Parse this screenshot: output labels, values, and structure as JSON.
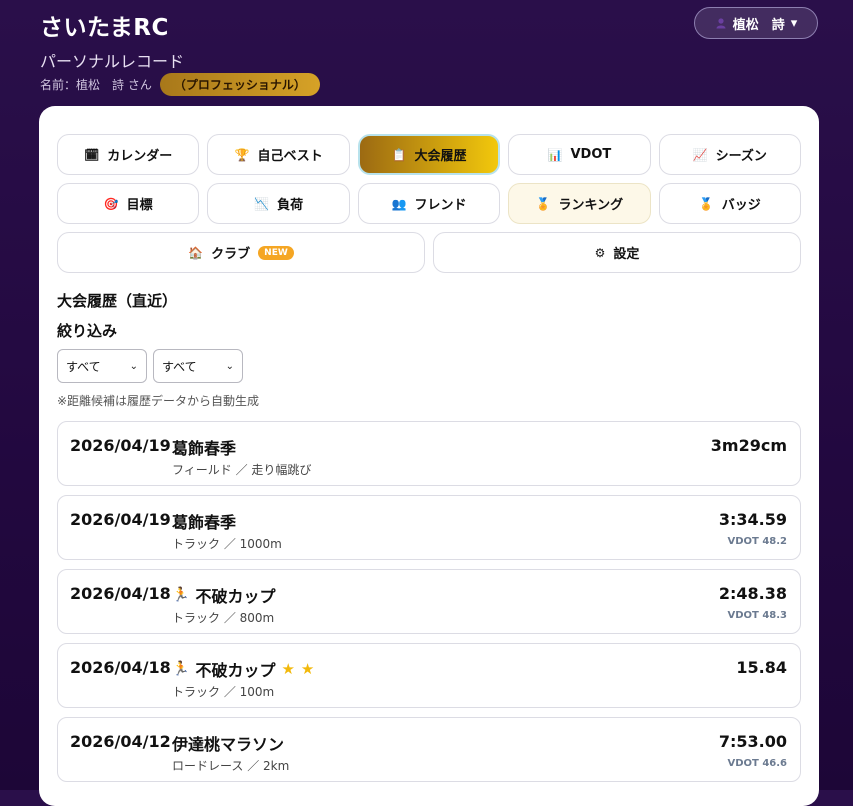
{
  "header": {
    "app_title": "さいたまRC",
    "subtitle": "パーソナルレコード",
    "name_line": "名前：植松　詩 さん",
    "rank": "（プロフェッショナル）"
  },
  "user_menu": {
    "label": "植松　詩",
    "chevron": "▾",
    "icon": "user-icon"
  },
  "tabs": [
    {
      "label": "カレンダー",
      "icon": "🗓"
    },
    {
      "label": "自己ベスト",
      "icon": "🏆"
    },
    {
      "label": "大会履歴",
      "icon": "📋",
      "active": true
    },
    {
      "label": "VDOT",
      "icon": "📊"
    },
    {
      "label": "シーズン",
      "icon": "📈"
    },
    {
      "label": "目標",
      "icon": "🎯"
    },
    {
      "label": "負荷",
      "icon": "📉"
    },
    {
      "label": "フレンド",
      "icon": "👥"
    },
    {
      "label": "ランキング",
      "icon": "🏅"
    },
    {
      "label": "バッジ",
      "icon": "🏅"
    }
  ],
  "tabs_row2": [
    {
      "label": "クラブ",
      "icon": "🏠",
      "badge": "NEW"
    },
    {
      "label": "設定",
      "icon": "⚙"
    }
  ],
  "section_title": "大会履歴（直近）",
  "filter_title": "絞り込み",
  "filters": [
    {
      "value": "すべて"
    },
    {
      "value": "すべて"
    }
  ],
  "note": "※距離候補は履歴データから自動生成",
  "races": [
    {
      "date": "2026/04/19",
      "name": "葛飾春季",
      "category": "フィールド ／ 走り幅跳び",
      "result": "3m29cm",
      "vdot": "",
      "runner_icon": false,
      "stars": 0
    },
    {
      "date": "2026/04/19",
      "name": "葛飾春季",
      "category": "トラック ／ 1000m",
      "result": "3:34.59",
      "vdot": "VDOT 48.2",
      "runner_icon": false,
      "stars": 0
    },
    {
      "date": "2026/04/18",
      "name": "不破カップ",
      "category": "トラック ／ 800m",
      "result": "2:48.38",
      "vdot": "VDOT 48.3",
      "runner_icon": true,
      "stars": 0
    },
    {
      "date": "2026/04/18",
      "name": "不破カップ",
      "category": "トラック ／ 100m",
      "result": "15.84",
      "vdot": "",
      "runner_icon": true,
      "stars": 2
    },
    {
      "date": "2026/04/12",
      "name": "伊達桃マラソン",
      "category": "ロードレース ／ 2km",
      "result": "7:53.00",
      "vdot": "VDOT 46.6",
      "runner_icon": false,
      "stars": 0
    }
  ]
}
